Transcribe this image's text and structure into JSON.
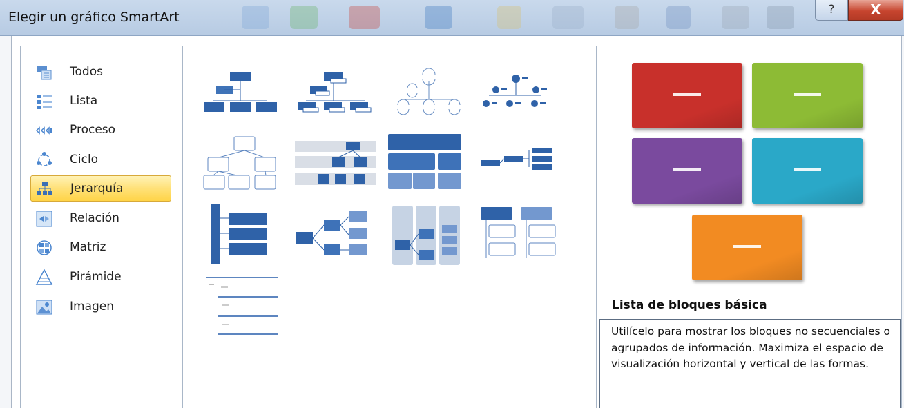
{
  "window": {
    "title": "Elegir un gráfico SmartArt",
    "help_glyph": "?",
    "close_glyph": "X"
  },
  "categories": [
    {
      "label": "Todos",
      "icon": "all-layouts-icon"
    },
    {
      "label": "Lista",
      "icon": "list-icon"
    },
    {
      "label": "Proceso",
      "icon": "process-icon"
    },
    {
      "label": "Ciclo",
      "icon": "cycle-icon"
    },
    {
      "label": "Jerarquía",
      "icon": "hierarchy-icon"
    },
    {
      "label": "Relación",
      "icon": "relationship-icon"
    },
    {
      "label": "Matriz",
      "icon": "matrix-icon"
    },
    {
      "label": "Pirámide",
      "icon": "pyramid-icon"
    },
    {
      "label": "Imagen",
      "icon": "picture-icon"
    }
  ],
  "selected_category": "Jerarquía",
  "layouts": [
    "organization-chart-layout",
    "name-and-title-org-chart-layout",
    "half-circle-org-chart-layout",
    "circle-picture-hierarchy-layout",
    "hierarchy-layout",
    "labeled-hierarchy-layout",
    "table-hierarchy-layout",
    "horizontal-hierarchy-layout",
    "vertical-bracket-list-layout",
    "horizontal-multilevel-hierarchy-layout",
    "horizontal-labeled-hierarchy-layout",
    "hierarchy-list-layout",
    "lined-list-layout"
  ],
  "preview": {
    "title": "Lista de bloques básica",
    "description": "Utilícelo para mostrar los bloques no secuenciales o agrupados de información. Maximiza el espacio de visualización horizontal y vertical de las formas.",
    "block_colors": [
      "#c8302b",
      "#8dbb35",
      "#7a4a9e",
      "#2aa8c8",
      "#f28b22"
    ]
  }
}
